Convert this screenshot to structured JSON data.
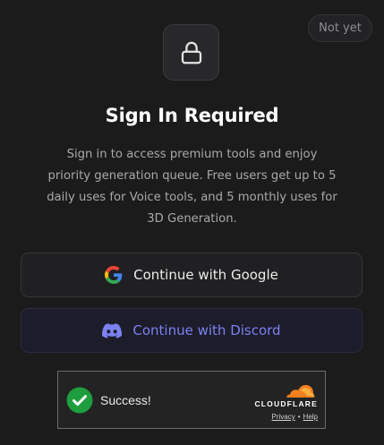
{
  "dialog": {
    "dismiss_label": "Not yet",
    "lock_icon": "lock-icon",
    "title": "Sign In Required",
    "description": "Sign in to access premium tools and enjoy priority generation queue. Free users get up to 5 daily uses for Voice tools, and 5 monthly uses for 3D Generation."
  },
  "auth": {
    "google_label": "Continue with Google",
    "google_icon": "google-icon",
    "discord_label": "Continue with Discord",
    "discord_icon": "discord-icon",
    "discord_color": "#7b82f0"
  },
  "captcha": {
    "status": "Success!",
    "status_icon": "check-circle-icon",
    "brand": "CLOUDFLARE",
    "privacy_label": "Privacy",
    "separator": "•",
    "help_label": "Help",
    "success_color": "#1e9e3e",
    "brand_color": "#f38020"
  }
}
